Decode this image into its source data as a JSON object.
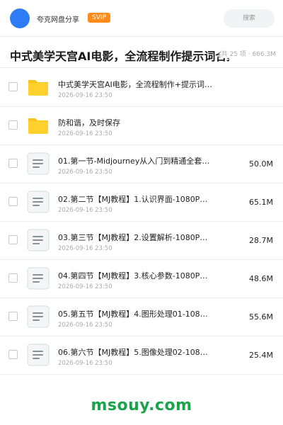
{
  "header": {
    "brand": "夸克网盘分享",
    "badge": "SVIP",
    "search_placeholder": "搜索",
    "accent_color": "#2f7bf5",
    "badge_color": "#ff8c1a"
  },
  "share": {
    "title": "中式美学天宫AI电影，全流程制作提示词合集、",
    "meta": "共 25 项 · 666.3M"
  },
  "files": [
    {
      "type": "folder",
      "icon": "folder-icon",
      "name": "中式美学天宫AI电影，全流程制作+提示词合集",
      "date": "2026-09-16 23:50",
      "size": ""
    },
    {
      "type": "folder",
      "icon": "folder-icon",
      "name": "防和谐，及时保存",
      "date": "2026-09-16 23:50",
      "size": ""
    },
    {
      "type": "doc",
      "icon": "document-icon",
      "name": "01.第一节-Midjourney从入门到精通全套…",
      "date": "2026-09-16 23:50",
      "size": "50.0M"
    },
    {
      "type": "doc",
      "icon": "document-icon",
      "name": "02.第二节【MJ教程】1.认识界面-1080P高…",
      "date": "2026-09-16 23:50",
      "size": "65.1M"
    },
    {
      "type": "doc",
      "icon": "document-icon",
      "name": "03.第三节【MJ教程】2.设置解析-1080P高…",
      "date": "2026-09-16 23:50",
      "size": "28.7M"
    },
    {
      "type": "doc",
      "icon": "document-icon",
      "name": "04.第四节【MJ教程】3.核心参数-1080P高…",
      "date": "2026-09-16 23:50",
      "size": "48.6M"
    },
    {
      "type": "doc",
      "icon": "document-icon",
      "name": "05.第五节【MJ教程】4.图形处理01-1080…",
      "date": "2026-09-16 23:50",
      "size": "55.6M"
    },
    {
      "type": "doc",
      "icon": "document-icon",
      "name": "06.第六节【MJ教程】5.图像处理02-1080…",
      "date": "2026-09-16 23:50",
      "size": "25.4M"
    }
  ],
  "watermark": {
    "text": "msouy.com",
    "color": "#1aa34a"
  }
}
